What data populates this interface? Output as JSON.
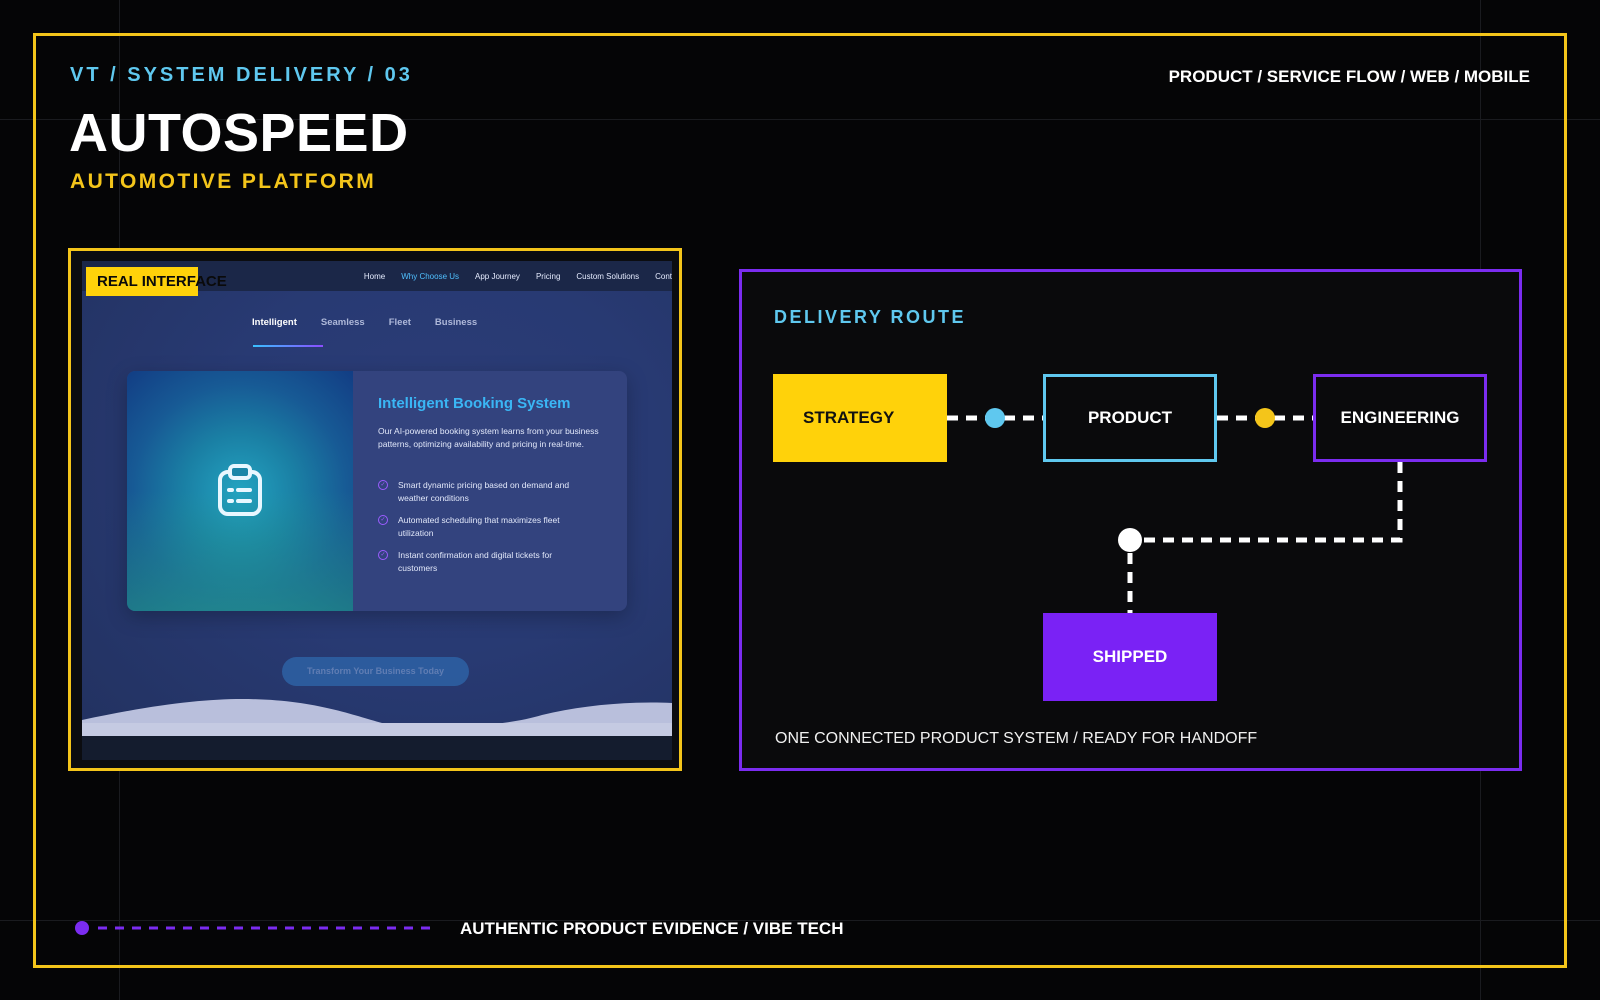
{
  "header": {
    "kicker": "VT / SYSTEM DELIVERY / 03",
    "title": "AUTOSPEED",
    "subtitle": "AUTOMOTIVE PLATFORM",
    "tagline": "PRODUCT / SERVICE FLOW / WEB / MOBILE"
  },
  "screenshot": {
    "badge": "REAL INTERFACE",
    "nav": [
      "Home",
      "Why Choose Us",
      "App Journey",
      "Pricing",
      "Custom Solutions",
      "Cont"
    ],
    "nav_active": "Why Choose Us",
    "tabs": [
      "Intelligent",
      "Seamless",
      "Fleet",
      "Business"
    ],
    "tab_active": "Intelligent",
    "card": {
      "icon": "clipboard-icon",
      "title": "Intelligent Booking System",
      "description": "Our AI-powered booking system learns from your business patterns, optimizing availability and pricing in real-time.",
      "features": [
        "Smart dynamic pricing based on demand and weather conditions",
        "Automated scheduling that maximizes fleet utilization",
        "Instant confirmation and digital tickets for customers"
      ]
    },
    "cta": "Transform Your Business Today"
  },
  "route": {
    "label": "DELIVERY ROUTE",
    "nodes": {
      "strategy": "STRATEGY",
      "product": "PRODUCT",
      "engineering": "ENGINEERING",
      "shipped": "SHIPPED"
    },
    "caption": "ONE CONNECTED PRODUCT SYSTEM / READY FOR HANDOFF"
  },
  "footer": {
    "text": "AUTHENTIC PRODUCT EVIDENCE / VIBE TECH"
  },
  "colors": {
    "background": "#050506",
    "yellow": "#f4c51a",
    "cyan": "#5fc8ef",
    "purple": "#7b2cf0",
    "shipped": "#7a22f5"
  }
}
